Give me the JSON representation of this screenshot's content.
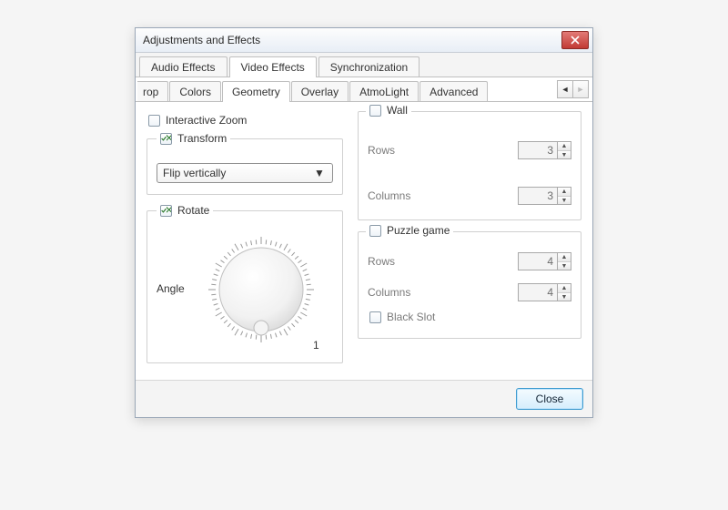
{
  "window": {
    "title": "Adjustments and Effects"
  },
  "topTabs": {
    "audio": "Audio Effects",
    "video": "Video Effects",
    "sync": "Synchronization",
    "activeIndex": 1
  },
  "subTabs": {
    "crop": "rop",
    "colors": "Colors",
    "geometry": "Geometry",
    "overlay": "Overlay",
    "atmo": "AtmoLight",
    "advanced": "Advanced",
    "activeIndex": 2
  },
  "geometry": {
    "interactiveZoom": {
      "label": "Interactive Zoom",
      "checked": false
    },
    "transform": {
      "label": "Transform",
      "checked": true,
      "selected": "Flip vertically"
    },
    "rotate": {
      "label": "Rotate",
      "checked": true,
      "angleLabel": "Angle",
      "angleValue": "1"
    },
    "wall": {
      "label": "Wall",
      "checked": false,
      "rowsLabel": "Rows",
      "rows": "3",
      "colsLabel": "Columns",
      "cols": "3"
    },
    "puzzle": {
      "label": "Puzzle game",
      "checked": false,
      "rowsLabel": "Rows",
      "rows": "4",
      "colsLabel": "Columns",
      "cols": "4",
      "blackSlotLabel": "Black Slot",
      "blackSlotChecked": false
    }
  },
  "footer": {
    "close": "Close"
  }
}
